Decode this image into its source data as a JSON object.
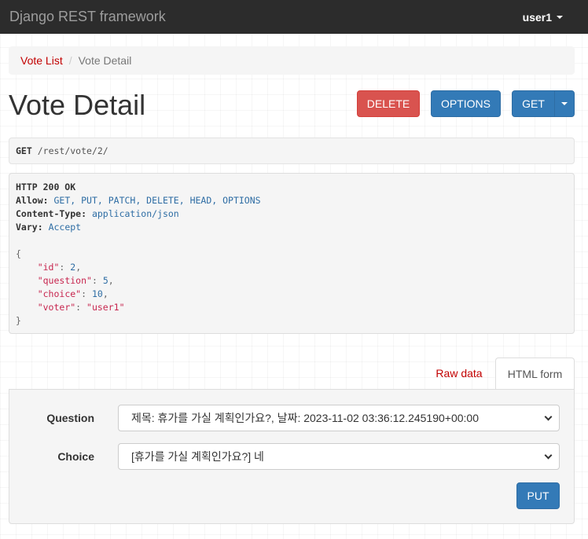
{
  "navbar": {
    "brand": "Django REST framework",
    "user": "user1"
  },
  "breadcrumb": {
    "items": [
      "Vote List",
      "Vote Detail"
    ]
  },
  "page_title": "Vote Detail",
  "buttons": {
    "delete": "DELETE",
    "options": "OPTIONS",
    "get": "GET",
    "put": "PUT"
  },
  "request": {
    "method": "GET",
    "path": "/rest/vote/2/"
  },
  "response": {
    "status": "HTTP 200 OK",
    "headers": [
      {
        "name": "Allow:",
        "value": "GET, PUT, PATCH, DELETE, HEAD, OPTIONS"
      },
      {
        "name": "Content-Type:",
        "value": "application/json"
      },
      {
        "name": "Vary:",
        "value": "Accept"
      }
    ],
    "body_open": "{",
    "body_close": "}",
    "fields": [
      {
        "key": "\"id\"",
        "value": "2",
        "type": "num"
      },
      {
        "key": "\"question\"",
        "value": "5",
        "type": "num"
      },
      {
        "key": "\"choice\"",
        "value": "10",
        "type": "num"
      },
      {
        "key": "\"voter\"",
        "value": "\"user1\"",
        "type": "str"
      }
    ]
  },
  "tabs": {
    "raw": "Raw data",
    "html": "HTML form"
  },
  "form": {
    "question_label": "Question",
    "question_value": "제목: 휴가를 가실 계획인가요?, 날짜: 2023-11-02 03:36:12.245190+00:00",
    "choice_label": "Choice",
    "choice_value": "[휴가를 가실 계획인가요?] 네"
  },
  "colors": {
    "navbar": "#2c2c2c",
    "primary": "#337ab7",
    "danger": "#d9534f",
    "link": "#c20000"
  }
}
